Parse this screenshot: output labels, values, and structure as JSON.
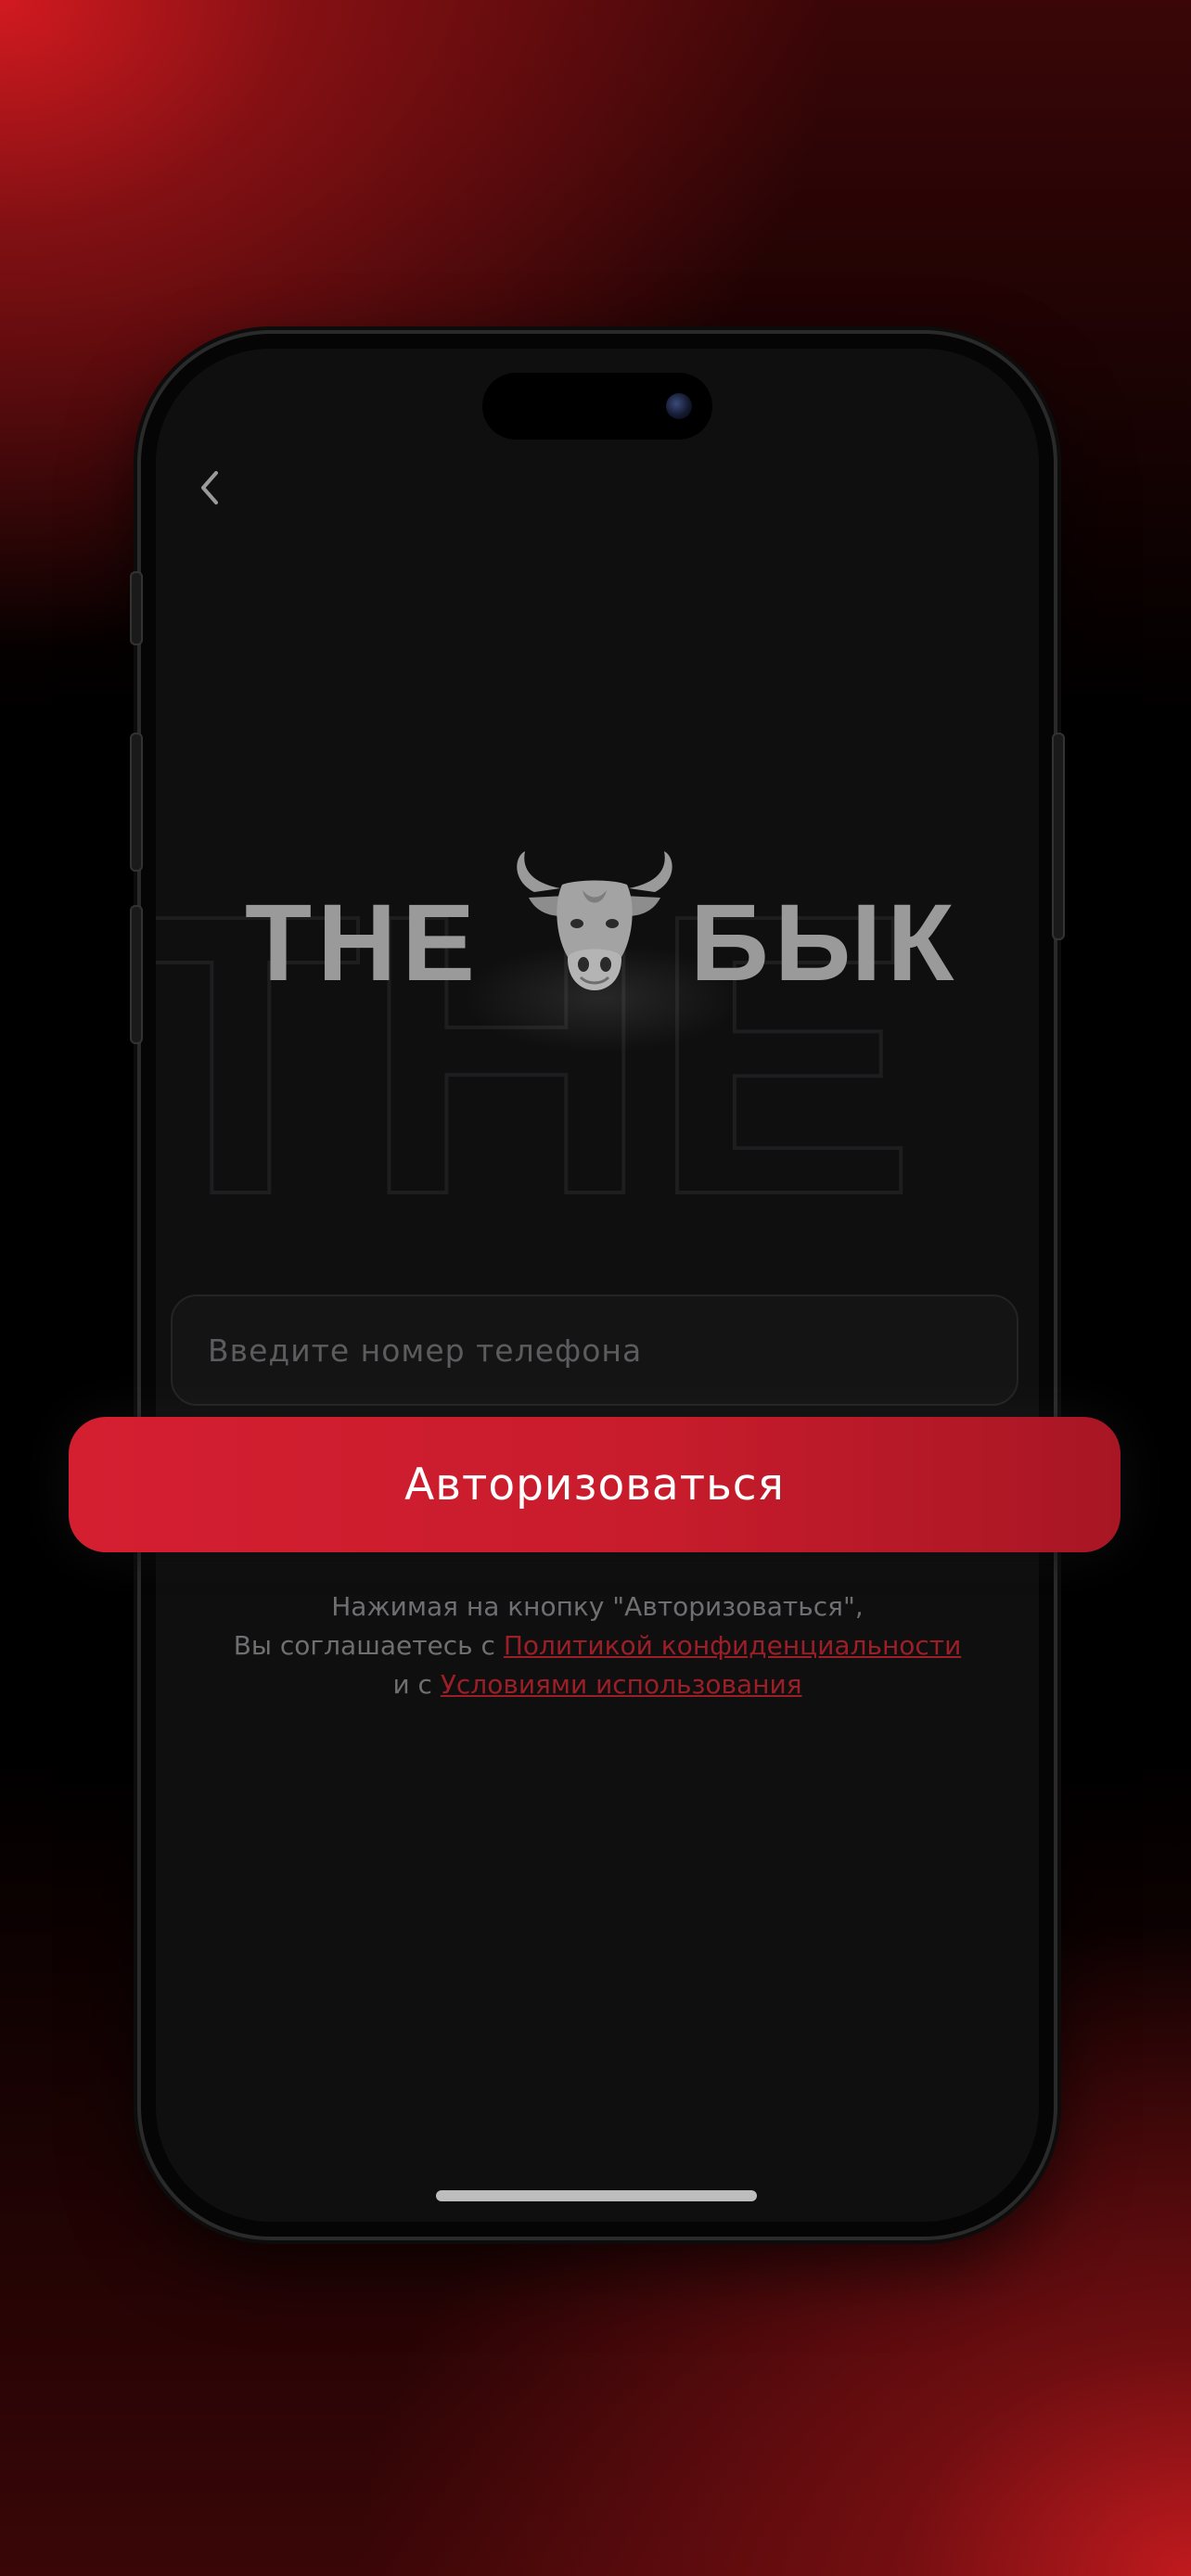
{
  "brand": {
    "left_word": "THE",
    "right_word": "БЫК",
    "logo_color": "#9a9a9a"
  },
  "navigation": {
    "back_icon": "chevron-left-icon"
  },
  "login_form": {
    "phone_placeholder": "Введите номер телефона",
    "submit_label": "Авторизоваться"
  },
  "terms": {
    "line1": "Нажимая на кнопку \"Авторизоваться\",",
    "line2_prefix": "Вы соглашаетесь с ",
    "privacy_link": "Политикой конфиденциальности",
    "line3_prefix": "и с ",
    "terms_link": "Условиями использования"
  },
  "colors": {
    "accent": "#d41f31",
    "link": "#9c1e26",
    "screen_bg": "#0f0f10"
  }
}
